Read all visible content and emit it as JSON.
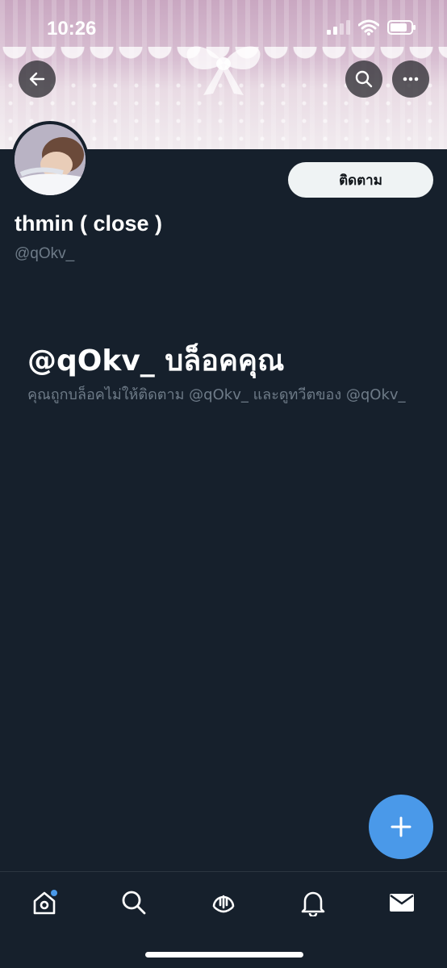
{
  "status_bar": {
    "time": "10:26"
  },
  "profile": {
    "display_name": "thmin ( close )",
    "handle": "@qOkv_",
    "follow_label": "ติดตาม"
  },
  "blocked": {
    "title": "@qOkv_ บล็อคคุณ",
    "description": "คุณถูกบล็อคไม่ให้ติดตาม @qOkv_ และดูทวีตของ @qOkv_"
  },
  "icons": {
    "back": "arrow-left-icon",
    "search": "search-icon",
    "more": "more-horizontal-icon",
    "compose": "plus-icon",
    "nav": [
      "home-icon",
      "search-icon",
      "spaces-icon",
      "bell-icon",
      "mail-icon"
    ]
  },
  "colors": {
    "background": "#16202c",
    "accent": "#4a99e9",
    "secondary_text": "#6e7b88"
  }
}
